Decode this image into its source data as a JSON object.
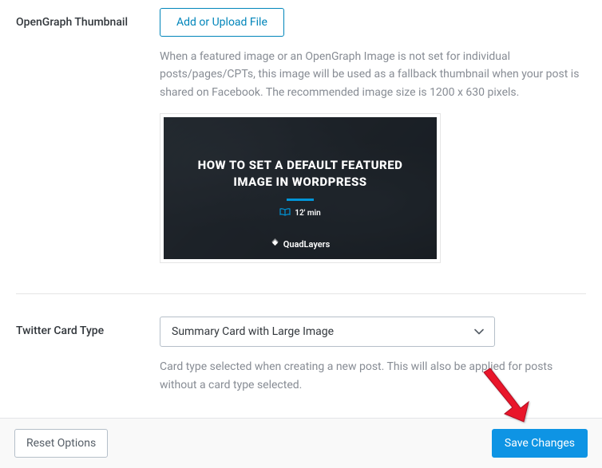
{
  "section_open_graph": {
    "label": "OpenGraph Thumbnail",
    "upload_button": "Add or Upload File",
    "description": "When a featured image or an OpenGraph Image is not set for individual posts/pages/CPTs, this image will be used as a fallback thumbnail when your post is shared on Facebook. The recommended image size is 1200 x 630 pixels.",
    "preview": {
      "title_line1": "HOW TO SET A DEFAULT FEATURED",
      "title_line2": "IMAGE IN WORDPRESS",
      "read_time": "12' min",
      "brand": "QuadLayers"
    }
  },
  "section_twitter": {
    "label": "Twitter Card Type",
    "selected": "Summary Card with Large Image",
    "description": "Card type selected when creating a new post. This will also be applied for posts without a card type selected."
  },
  "footer": {
    "reset": "Reset Options",
    "save": "Save Changes"
  }
}
